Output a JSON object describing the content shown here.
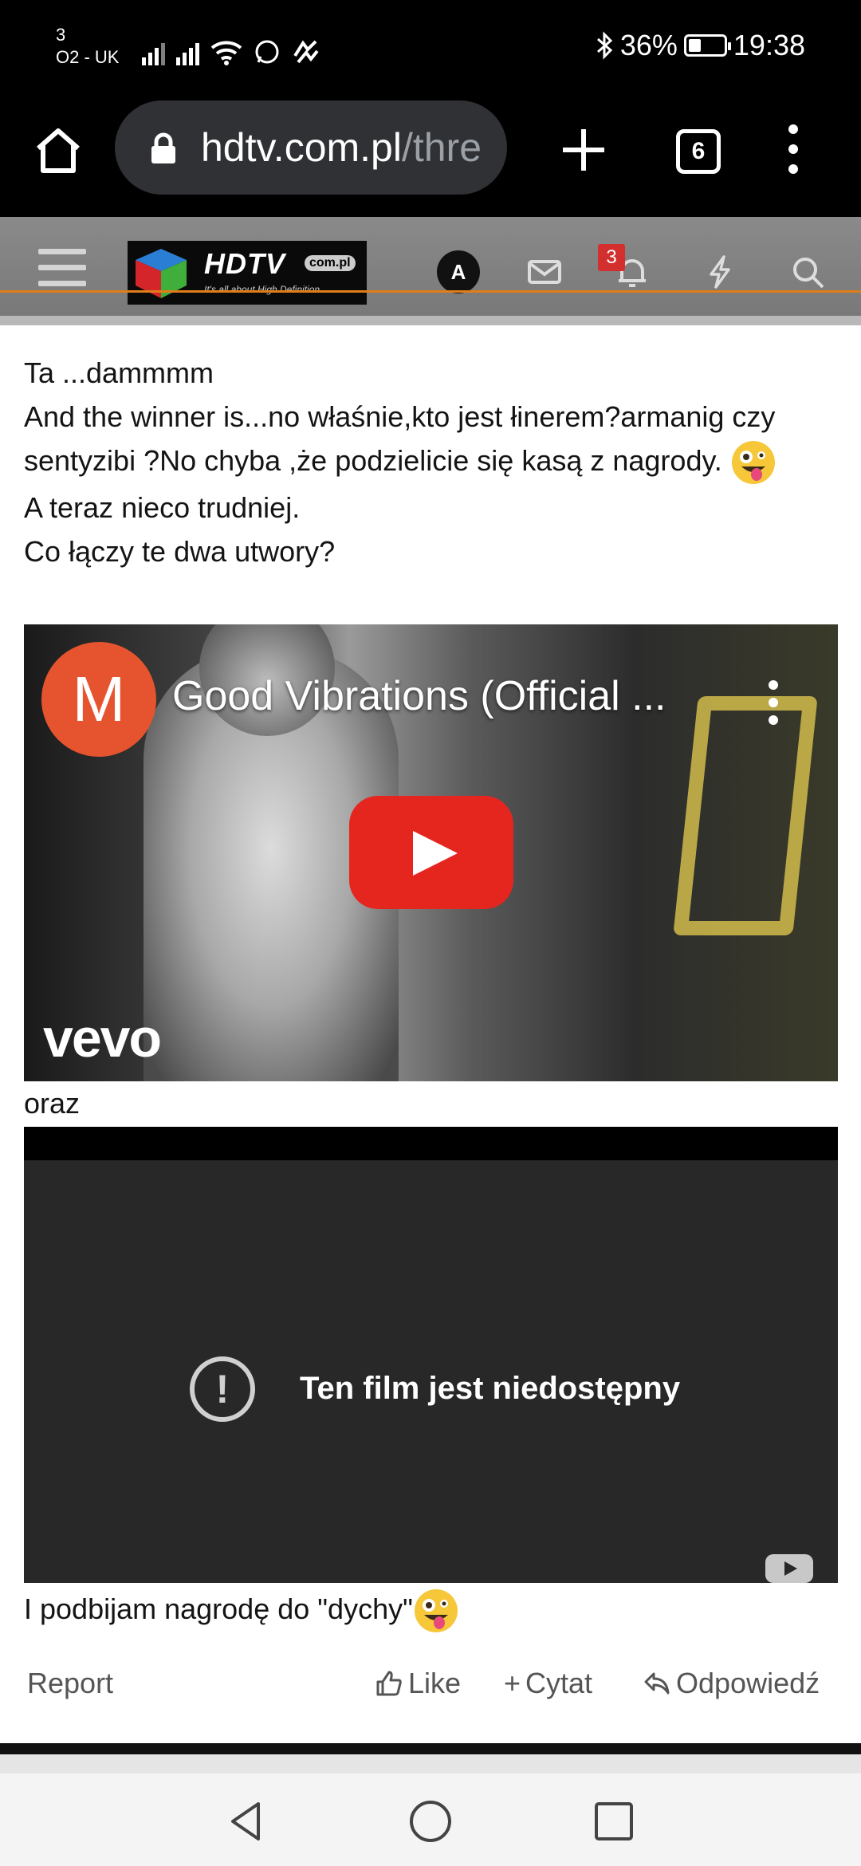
{
  "status_bar": {
    "carrier_line1": "3",
    "carrier_line2": "O2 - UK",
    "battery_pct": "36%",
    "battery_level": 0.36,
    "time": "19:38"
  },
  "browser": {
    "url_host": "hdtv.com.pl",
    "url_path": "/thre",
    "tab_count": "6"
  },
  "site_header": {
    "logo_brand": "HDTV",
    "logo_tld": "com.pl",
    "logo_tagline": "It's all about High Definition",
    "avatar_initials": "A",
    "notifications_count": "3"
  },
  "post": {
    "lines": [
      "Ta ...dammmm",
      "And the winner is...no właśnie,kto jest łinerem?armanig czy sentyzibi ?No chyba ,że podzielicie się kasą z nagrody.",
      "A teraz nieco trudniej.",
      "Co łączy te dwa utwory?"
    ],
    "video1": {
      "channel_initial": "M",
      "title": "Good Vibrations (Official ...",
      "watermark": "vevo"
    },
    "between_text": "oraz",
    "video2": {
      "unavailable_text": "Ten film jest niedostępny"
    },
    "last_line": "I podbijam nagrodę do \"dychy\""
  },
  "actions": {
    "report": "Report",
    "like": "Like",
    "quote": "Cytat",
    "reply": "Odpowiedź"
  },
  "icons": [
    "home-icon",
    "lock-icon",
    "plus-icon",
    "tabs-icon",
    "more-vert-icon",
    "hamburger-icon",
    "mail-icon",
    "bell-icon",
    "bolt-icon",
    "search-icon",
    "thumbs-up-icon",
    "reply-icon",
    "back-icon",
    "home-circle-icon",
    "recents-icon"
  ]
}
